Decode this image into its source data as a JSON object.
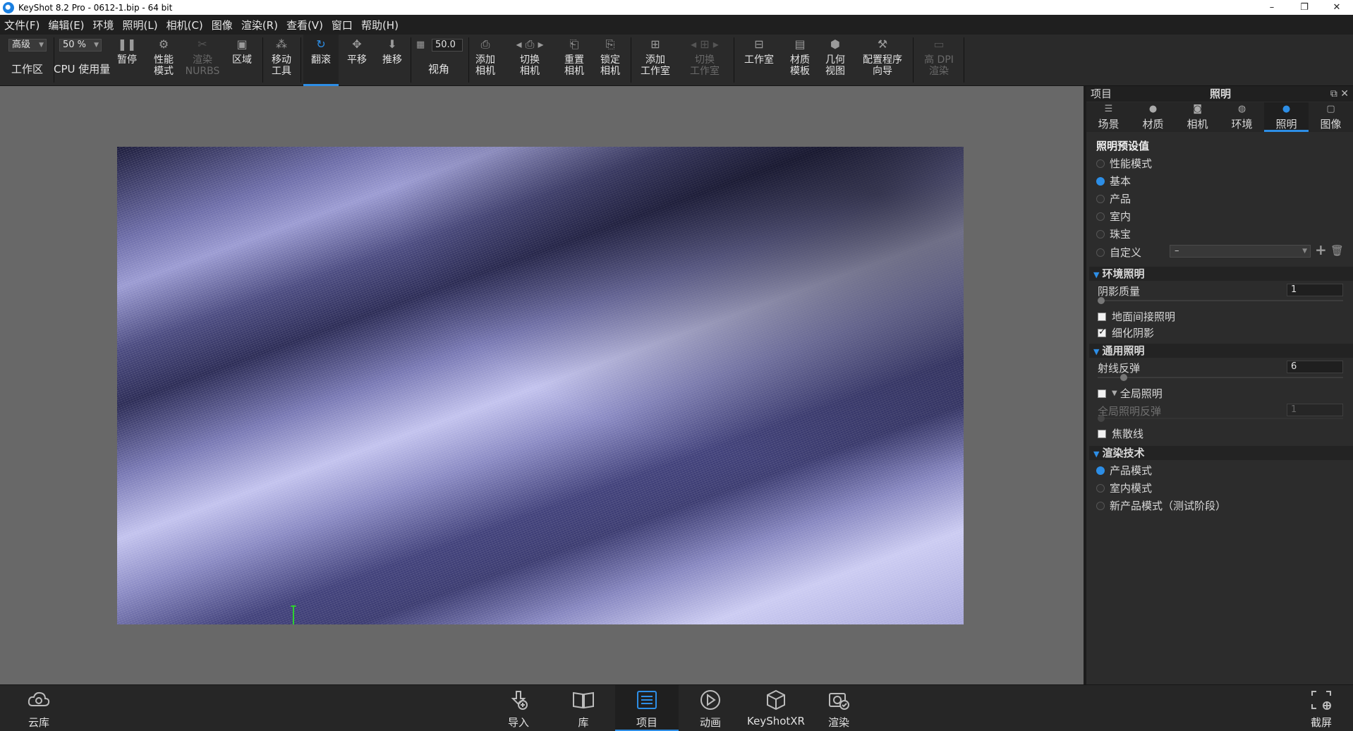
{
  "titlebar": {
    "title": "KeyShot 8.2 Pro  - 0612-1.bip  - 64 bit",
    "minimize": "–",
    "restore": "❐",
    "close": "✕"
  },
  "menu": [
    "文件(F)",
    "编辑(E)",
    "环境",
    "照明(L)",
    "相机(C)",
    "图像",
    "渲染(R)",
    "查看(V)",
    "窗口",
    "帮助(H)"
  ],
  "toolbar": {
    "quality_value": "高级",
    "workspace_label": "工作区",
    "cpu_value": "50 %",
    "cpu_label": "CPU 使用量",
    "pause_label": "暂停",
    "perf_label": [
      "性能",
      "模式"
    ],
    "nurbs_label": [
      "渲染",
      "NURBS"
    ],
    "region_label": "区域",
    "move_label": [
      "移动",
      "工具"
    ],
    "tumble_label": "翻滚",
    "pan_label": "平移",
    "dolly_label": "推移",
    "fov_value": "50.0",
    "fov_label": "视角",
    "add_camera_label": [
      "添加",
      "相机"
    ],
    "switch_camera_label": [
      "切换",
      "相机"
    ],
    "reset_camera_label": [
      "重置",
      "相机"
    ],
    "lock_camera_label": [
      "锁定",
      "相机"
    ],
    "add_studio_label": [
      "添加",
      "工作室"
    ],
    "switch_studio_label": [
      "切换",
      "工作室"
    ],
    "studio_label": "工作室",
    "material_template_label": [
      "材质",
      "模板"
    ],
    "geometry_view_label": [
      "几何",
      "视图"
    ],
    "config_wizard_label": [
      "配置程序",
      "向导"
    ],
    "hidpi_label": [
      "高 DPI",
      "渲染"
    ]
  },
  "panel": {
    "header_left": "项目",
    "header_center": "照明",
    "tabs": [
      "场景",
      "材质",
      "相机",
      "环境",
      "照明",
      "图像"
    ],
    "active_tab": "照明",
    "presets_title": "照明预设值",
    "presets": [
      {
        "label": "性能模式",
        "selected": false
      },
      {
        "label": "基本",
        "selected": true
      },
      {
        "label": "产品",
        "selected": false
      },
      {
        "label": "室内",
        "selected": false
      },
      {
        "label": "珠宝",
        "selected": false
      },
      {
        "label": "自定义",
        "selected": false
      }
    ],
    "custom_combo_value": "–",
    "env_section": "环境照明",
    "shadow_quality_label": "阴影质量",
    "shadow_quality_value": "1",
    "ground_indirect_label": "地面间接照明",
    "ground_indirect_checked": false,
    "refine_shadow_label": "细化阴影",
    "refine_shadow_checked": true,
    "general_section": "通用照明",
    "ray_bounce_label": "射线反弹",
    "ray_bounce_value": "6",
    "global_illum_label": "全局照明",
    "global_illum_checked": false,
    "gi_bounce_label": "全局照明反弹",
    "gi_bounce_value": "1",
    "caustics_label": "焦散线",
    "caustics_checked": false,
    "render_tech_section": "渲染技术",
    "render_tech": [
      {
        "label": "产品模式",
        "selected": true
      },
      {
        "label": "室内模式",
        "selected": false
      },
      {
        "label": "新产品模式（测试阶段）",
        "selected": false
      }
    ]
  },
  "dock": {
    "cloud_label": "云库",
    "import_label": "导入",
    "library_label": "库",
    "project_label": "项目",
    "animation_label": "动画",
    "keyshotxr_label": "KeyShotXR",
    "render_label": "渲染",
    "screenshot_label": "截屏",
    "active": "项目"
  },
  "colors": {
    "accent": "#2d8ee6",
    "viewport_bg": "#686868",
    "fabric": "#8a8ac4"
  }
}
